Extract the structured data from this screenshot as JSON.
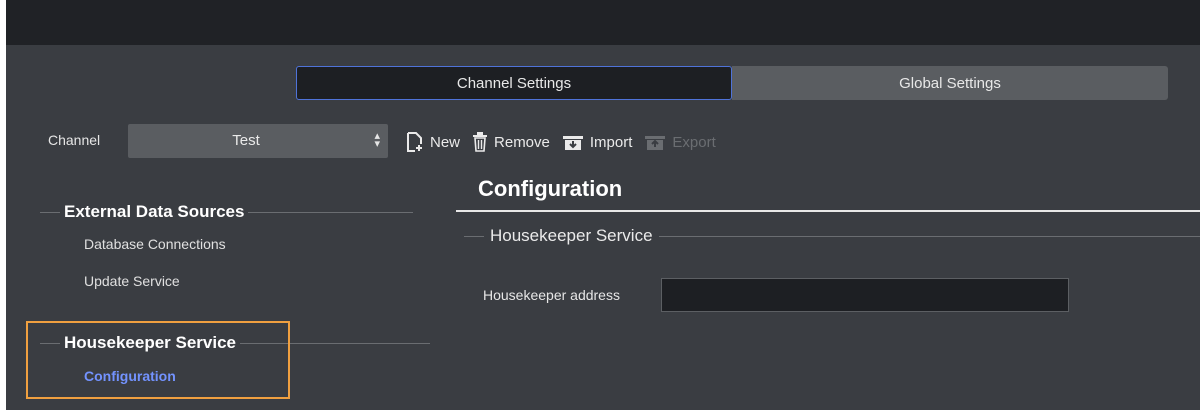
{
  "tabs": {
    "channel_settings": "Channel Settings",
    "global_settings": "Global Settings"
  },
  "channel": {
    "label": "Channel",
    "selected": "Test"
  },
  "toolbar": {
    "new": "New",
    "remove": "Remove",
    "import": "Import",
    "export": "Export"
  },
  "sidebar": {
    "groups": [
      {
        "title": "External Data Sources",
        "items": [
          {
            "label": "Database Connections"
          },
          {
            "label": "Update Service"
          }
        ]
      },
      {
        "title": "Housekeeper Service",
        "items": [
          {
            "label": "Configuration",
            "active": true
          }
        ]
      }
    ]
  },
  "main": {
    "title": "Configuration",
    "section_title": "Housekeeper Service",
    "field_label": "Housekeeper address",
    "field_value": ""
  },
  "colors": {
    "background": "#3a3d42",
    "titlebar": "#202226",
    "active_nav": "#7393ff",
    "tab_border": "#4f73d9",
    "highlight": "#f0a040"
  }
}
